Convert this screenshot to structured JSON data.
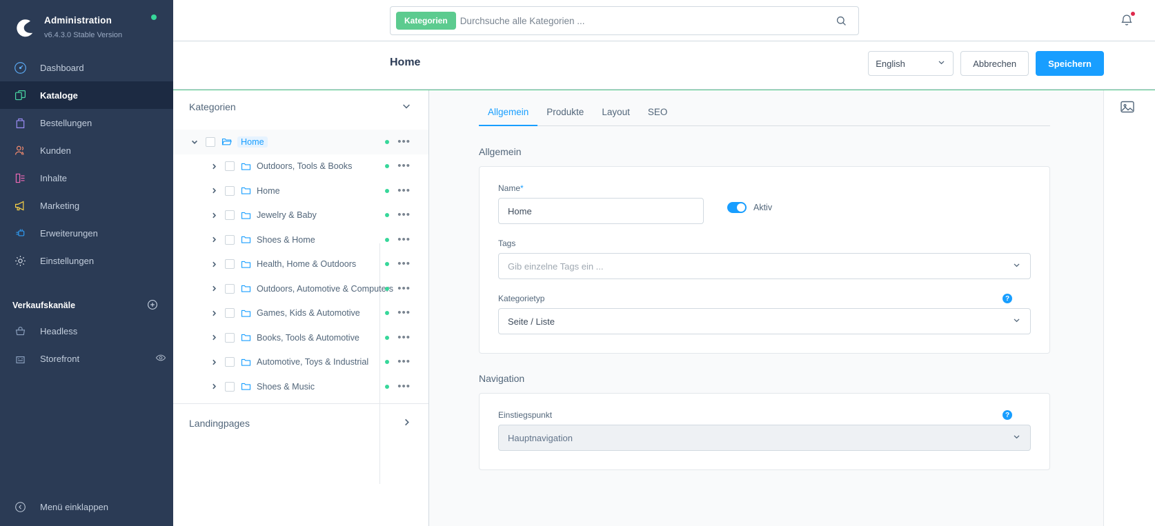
{
  "sidebar": {
    "brand": {
      "title": "Administration",
      "version": "v6.4.3.0 Stable Version"
    },
    "items": [
      {
        "label": "Dashboard",
        "icon": "dashboard-icon",
        "active": false
      },
      {
        "label": "Kataloge",
        "icon": "catalogue-icon",
        "active": true
      },
      {
        "label": "Bestellungen",
        "icon": "orders-icon",
        "active": false
      },
      {
        "label": "Kunden",
        "icon": "customers-icon",
        "active": false
      },
      {
        "label": "Inhalte",
        "icon": "content-icon",
        "active": false
      },
      {
        "label": "Marketing",
        "icon": "megaphone-icon",
        "active": false
      },
      {
        "label": "Erweiterungen",
        "icon": "plugin-icon",
        "active": false
      },
      {
        "label": "Einstellungen",
        "icon": "gear-icon",
        "active": false
      }
    ],
    "group_title": "Verkaufskanäle",
    "channels": [
      {
        "label": "Headless",
        "icon": "basket-icon"
      },
      {
        "label": "Storefront",
        "icon": "storefront-icon"
      }
    ],
    "collapse_label": "Menü einklappen"
  },
  "topbar": {
    "search_scope": "Kategorien",
    "search_value": "",
    "search_placeholder": "Durchsuche alle Kategorien ..."
  },
  "header": {
    "title": "Home",
    "language": "English",
    "cancel_label": "Abbrechen",
    "save_label": "Speichern"
  },
  "tree": {
    "header": "Kategorien",
    "landingpages": "Landingpages",
    "items": [
      {
        "label": "Home",
        "level": 0,
        "selected": true,
        "expanded": true
      },
      {
        "label": "Outdoors, Tools & Books",
        "level": 1,
        "selected": false,
        "expanded": false
      },
      {
        "label": "Home",
        "level": 1,
        "selected": false,
        "expanded": false
      },
      {
        "label": "Jewelry & Baby",
        "level": 1,
        "selected": false,
        "expanded": false
      },
      {
        "label": "Shoes & Home",
        "level": 1,
        "selected": false,
        "expanded": false
      },
      {
        "label": "Health, Home & Outdoors",
        "level": 1,
        "selected": false,
        "expanded": false
      },
      {
        "label": "Outdoors, Automotive & Computers",
        "level": 1,
        "selected": false,
        "expanded": false
      },
      {
        "label": "Games, Kids & Automotive",
        "level": 1,
        "selected": false,
        "expanded": false
      },
      {
        "label": "Books, Tools & Automotive",
        "level": 1,
        "selected": false,
        "expanded": false
      },
      {
        "label": "Automotive, Toys & Industrial",
        "level": 1,
        "selected": false,
        "expanded": false
      },
      {
        "label": "Shoes & Music",
        "level": 1,
        "selected": false,
        "expanded": false
      }
    ]
  },
  "main": {
    "tabs": [
      {
        "label": "Allgemein",
        "active": true
      },
      {
        "label": "Produkte",
        "active": false
      },
      {
        "label": "Layout",
        "active": false
      },
      {
        "label": "SEO",
        "active": false
      }
    ],
    "general": {
      "section_title": "Allgemein",
      "name_label": "Name",
      "name_required": "*",
      "name_value": "Home",
      "active_label": "Aktiv",
      "active_on": true,
      "tags_label": "Tags",
      "tags_placeholder": "Gib einzelne Tags ein ...",
      "category_type_label": "Kategorietyp",
      "category_type_value": "Seite / Liste",
      "help_glyph": "?"
    },
    "navigation": {
      "section_title": "Navigation",
      "entry_label": "Einstiegspunkt",
      "entry_value": "Hauptnavigation",
      "help_glyph": "?"
    }
  },
  "colors": {
    "sidebar_bg": "#2b3b55",
    "accent_blue": "#189eff",
    "accent_green": "#5ccb8f",
    "status_green": "#37d79a",
    "badge_red": "#de294c"
  }
}
